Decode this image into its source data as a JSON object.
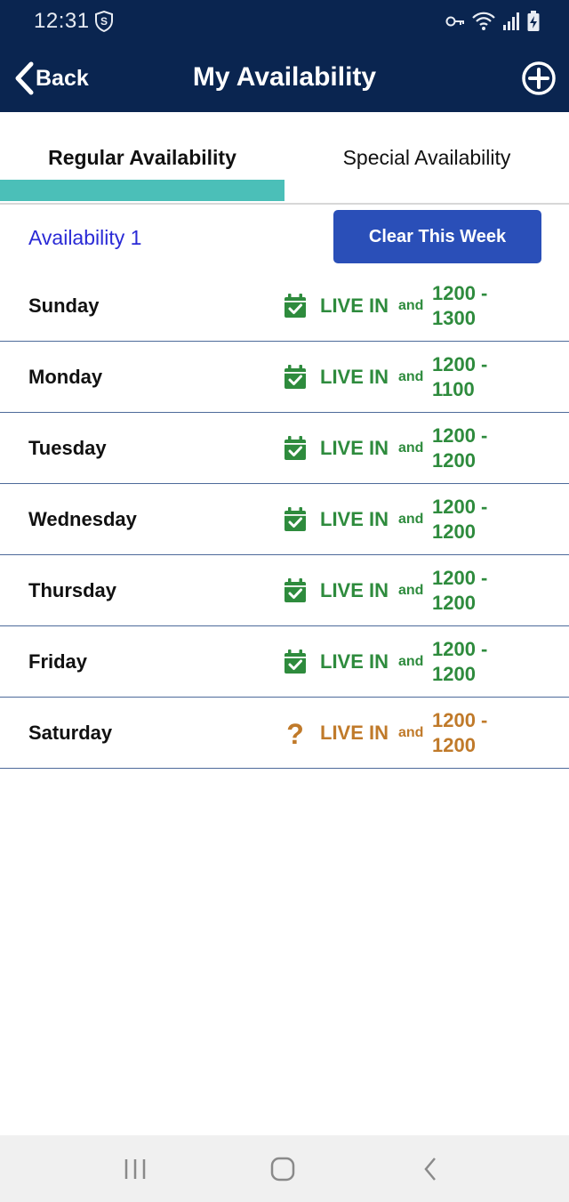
{
  "status_bar": {
    "time": "12:31"
  },
  "header": {
    "back_label": "Back",
    "title": "My Availability"
  },
  "tabs": [
    {
      "label": "Regular Availability",
      "active": true
    },
    {
      "label": "Special Availability",
      "active": false
    }
  ],
  "availability": {
    "name": "Availability 1",
    "clear_label": "Clear This Week"
  },
  "days": [
    {
      "day": "Sunday",
      "icon": "calendar-check-icon",
      "type": "LIVE IN",
      "joiner": "and",
      "time_start": "1200 -",
      "time_end": "1300",
      "color": "#2e8b3d"
    },
    {
      "day": "Monday",
      "icon": "calendar-check-icon",
      "type": "LIVE IN",
      "joiner": "and",
      "time_start": "1200 -",
      "time_end": "1100",
      "color": "#2e8b3d"
    },
    {
      "day": "Tuesday",
      "icon": "calendar-check-icon",
      "type": "LIVE IN",
      "joiner": "and",
      "time_start": "1200 -",
      "time_end": "1200",
      "color": "#2e8b3d"
    },
    {
      "day": "Wednesday",
      "icon": "calendar-check-icon",
      "type": "LIVE IN",
      "joiner": "and",
      "time_start": "1200 -",
      "time_end": "1200",
      "color": "#2e8b3d"
    },
    {
      "day": "Thursday",
      "icon": "calendar-check-icon",
      "type": "LIVE IN",
      "joiner": "and",
      "time_start": "1200 -",
      "time_end": "1200",
      "color": "#2e8b3d"
    },
    {
      "day": "Friday",
      "icon": "calendar-check-icon",
      "type": "LIVE IN",
      "joiner": "and",
      "time_start": "1200 -",
      "time_end": "1200",
      "color": "#2e8b3d"
    },
    {
      "day": "Saturday",
      "icon": "question-mark-icon",
      "type": "LIVE IN",
      "joiner": "and",
      "time_start": "1200 -",
      "time_end": "1200",
      "color": "#c07a2a"
    }
  ],
  "colors": {
    "header_bg": "#0a2550",
    "tab_indicator": "#4bbfb8",
    "clear_button": "#2a4fb8",
    "availability_link": "#2a2ad6",
    "available": "#2e8b3d",
    "uncertain": "#c07a2a"
  }
}
